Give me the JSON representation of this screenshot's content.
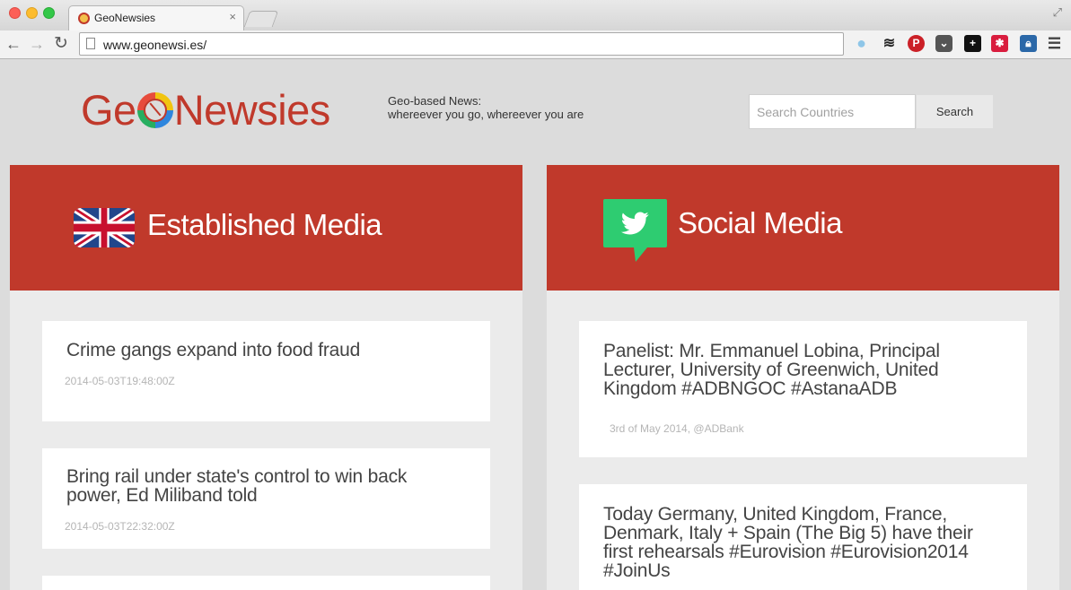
{
  "browser": {
    "tab_title": "GeoNewsies",
    "tab_close": "×",
    "url": "www.geonewsi.es/",
    "nav": {
      "back": "←",
      "forward": "→",
      "reload": "↻"
    }
  },
  "header": {
    "logo_prefix": "Ge",
    "logo_suffix": "Newsies",
    "tagline_line1": "Geo-based News:",
    "tagline_line2": "whereever you go, whereever you are",
    "search_placeholder": "Search Countries",
    "search_button": "Search"
  },
  "columns": {
    "established": {
      "title": "Established Media",
      "icon": "union-jack-flag-icon",
      "articles": [
        {
          "title": "Crime gangs expand into food fraud",
          "date": "2014-05-03T19:48:00Z"
        },
        {
          "title": "Bring rail under state's control to win back power, Ed Miliband told",
          "date": "2014-05-03T22:32:00Z"
        }
      ]
    },
    "social": {
      "title": "Social Media",
      "icon": "twitter-bird-icon",
      "tweets": [
        {
          "text": "Panelist: Mr. Emmanuel Lobina, Principal Lecturer, University of Greenwich, United Kingdom #ADBNGOC #AstanaADB",
          "meta": "3rd of May 2014, @ADBank"
        },
        {
          "text": "Today Germany, United Kingdom, France, Denmark, Italy + Spain (The Big 5) have their first rehearsals #Eurovision #Eurovision2014 #JoinUs",
          "meta": ""
        }
      ]
    }
  },
  "colors": {
    "accent": "#c0392b",
    "background": "#dcdcdc",
    "twitter_green": "#2ecc71"
  }
}
